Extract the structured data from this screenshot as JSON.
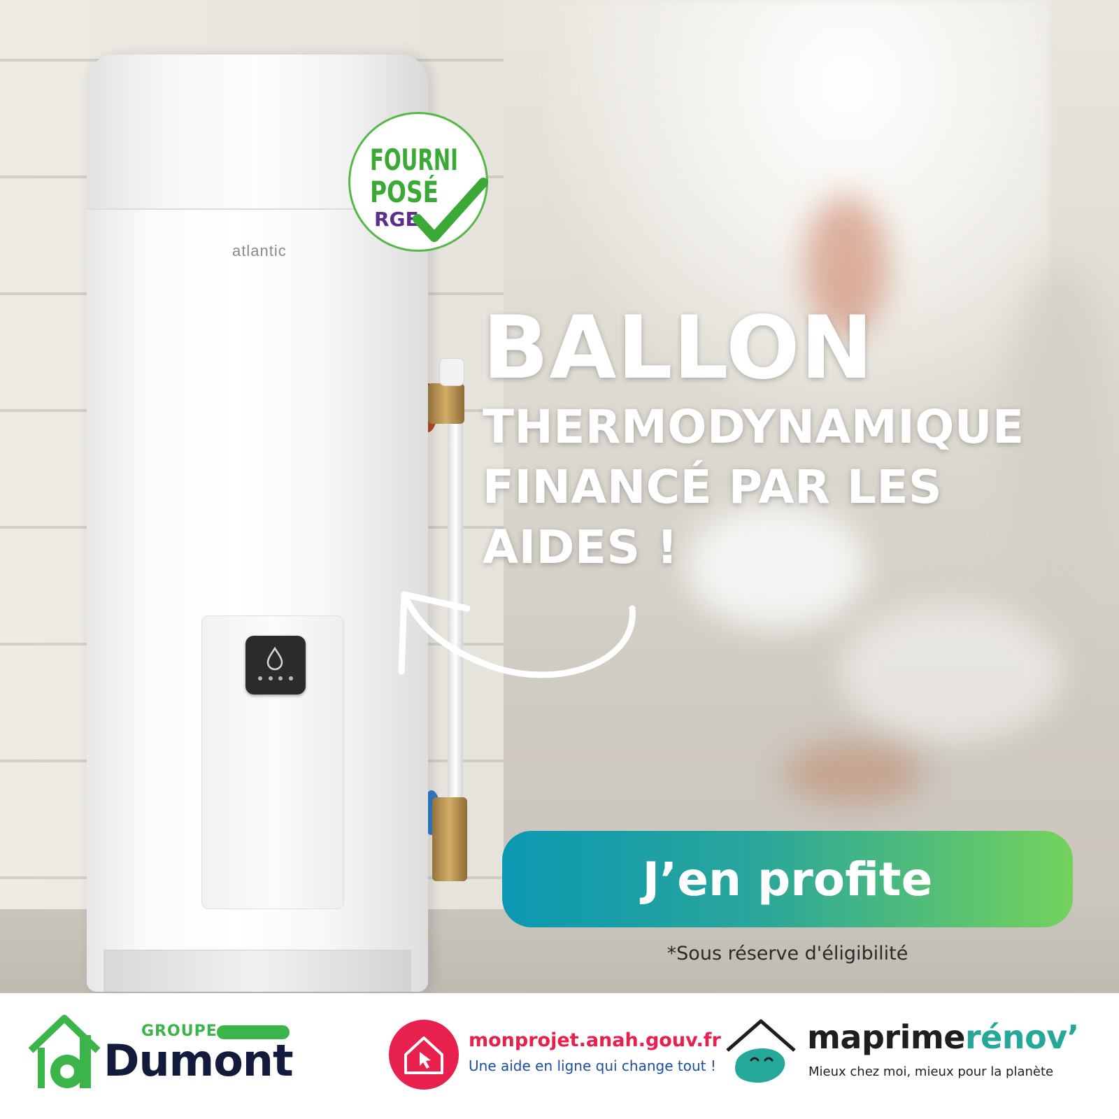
{
  "headline": {
    "line1": "BALLON",
    "line2": "THERMODYNAMIQUE",
    "line3": "FINANCÉ PAR LES",
    "line4": "AIDES !"
  },
  "product": {
    "brand_label": "atlantic"
  },
  "badge": {
    "line1": "FOURNI",
    "line2": "POSÉ",
    "line3": "RGE",
    "icon": "checkmark-icon"
  },
  "cta": {
    "label": "J’en profite"
  },
  "disclaimer": "*Sous réserve d'éligibilité",
  "footer": {
    "dumont": {
      "groupe": "GROUPE",
      "name": "Dumont"
    },
    "anah": {
      "url": "monprojet.anah.gouv.fr",
      "tagline": "Une aide en ligne qui change tout !"
    },
    "maprimerenov": {
      "name_part1": "maprime",
      "name_part2": "rénov’",
      "tagline": "Mieux chez moi, mieux pour la planète"
    }
  },
  "colors": {
    "cta_gradient_start": "#0b98b2",
    "cta_gradient_end": "#74d25c",
    "badge_green": "#3aa935",
    "badge_purple": "#5b2d8e",
    "dumont_green": "#3bb54a",
    "dumont_navy": "#131a3c",
    "anah_red": "#e7204e",
    "anah_blue": "#1b4ea0",
    "mpr_teal": "#25a89a"
  }
}
